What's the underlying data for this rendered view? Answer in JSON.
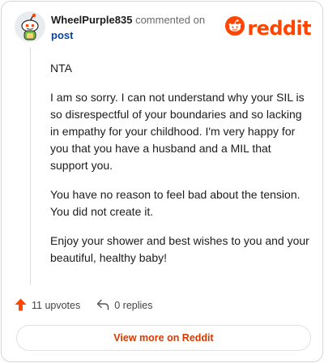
{
  "comment": {
    "author": "WheelPurple835",
    "action_text": "commented on",
    "post_link": "post",
    "paragraphs": [
      "NTA",
      "I am so sorry. I can not understand why your SIL is so disrespectful of your boundaries and so lacking in empathy for your childhood. I'm very happy for you that you have a husband and a MIL that support you.",
      "You have no reason to feel bad about the tension. You did not create it.",
      "Enjoy your shower and best wishes to you and your beautiful, healthy baby!"
    ]
  },
  "brand": {
    "name": "reddit",
    "color": "#ff4500"
  },
  "actions": {
    "upvotes": "11 upvotes",
    "replies": "0 replies"
  },
  "footer": {
    "view_more": "View more on Reddit"
  },
  "colors": {
    "upvote": "#ff4500",
    "link": "#0a449b",
    "view_more": "#d93900"
  },
  "icons": [
    "snoo-avatar-icon",
    "reddit-logo-icon",
    "upvote-arrow-icon",
    "reply-arrow-icon"
  ]
}
